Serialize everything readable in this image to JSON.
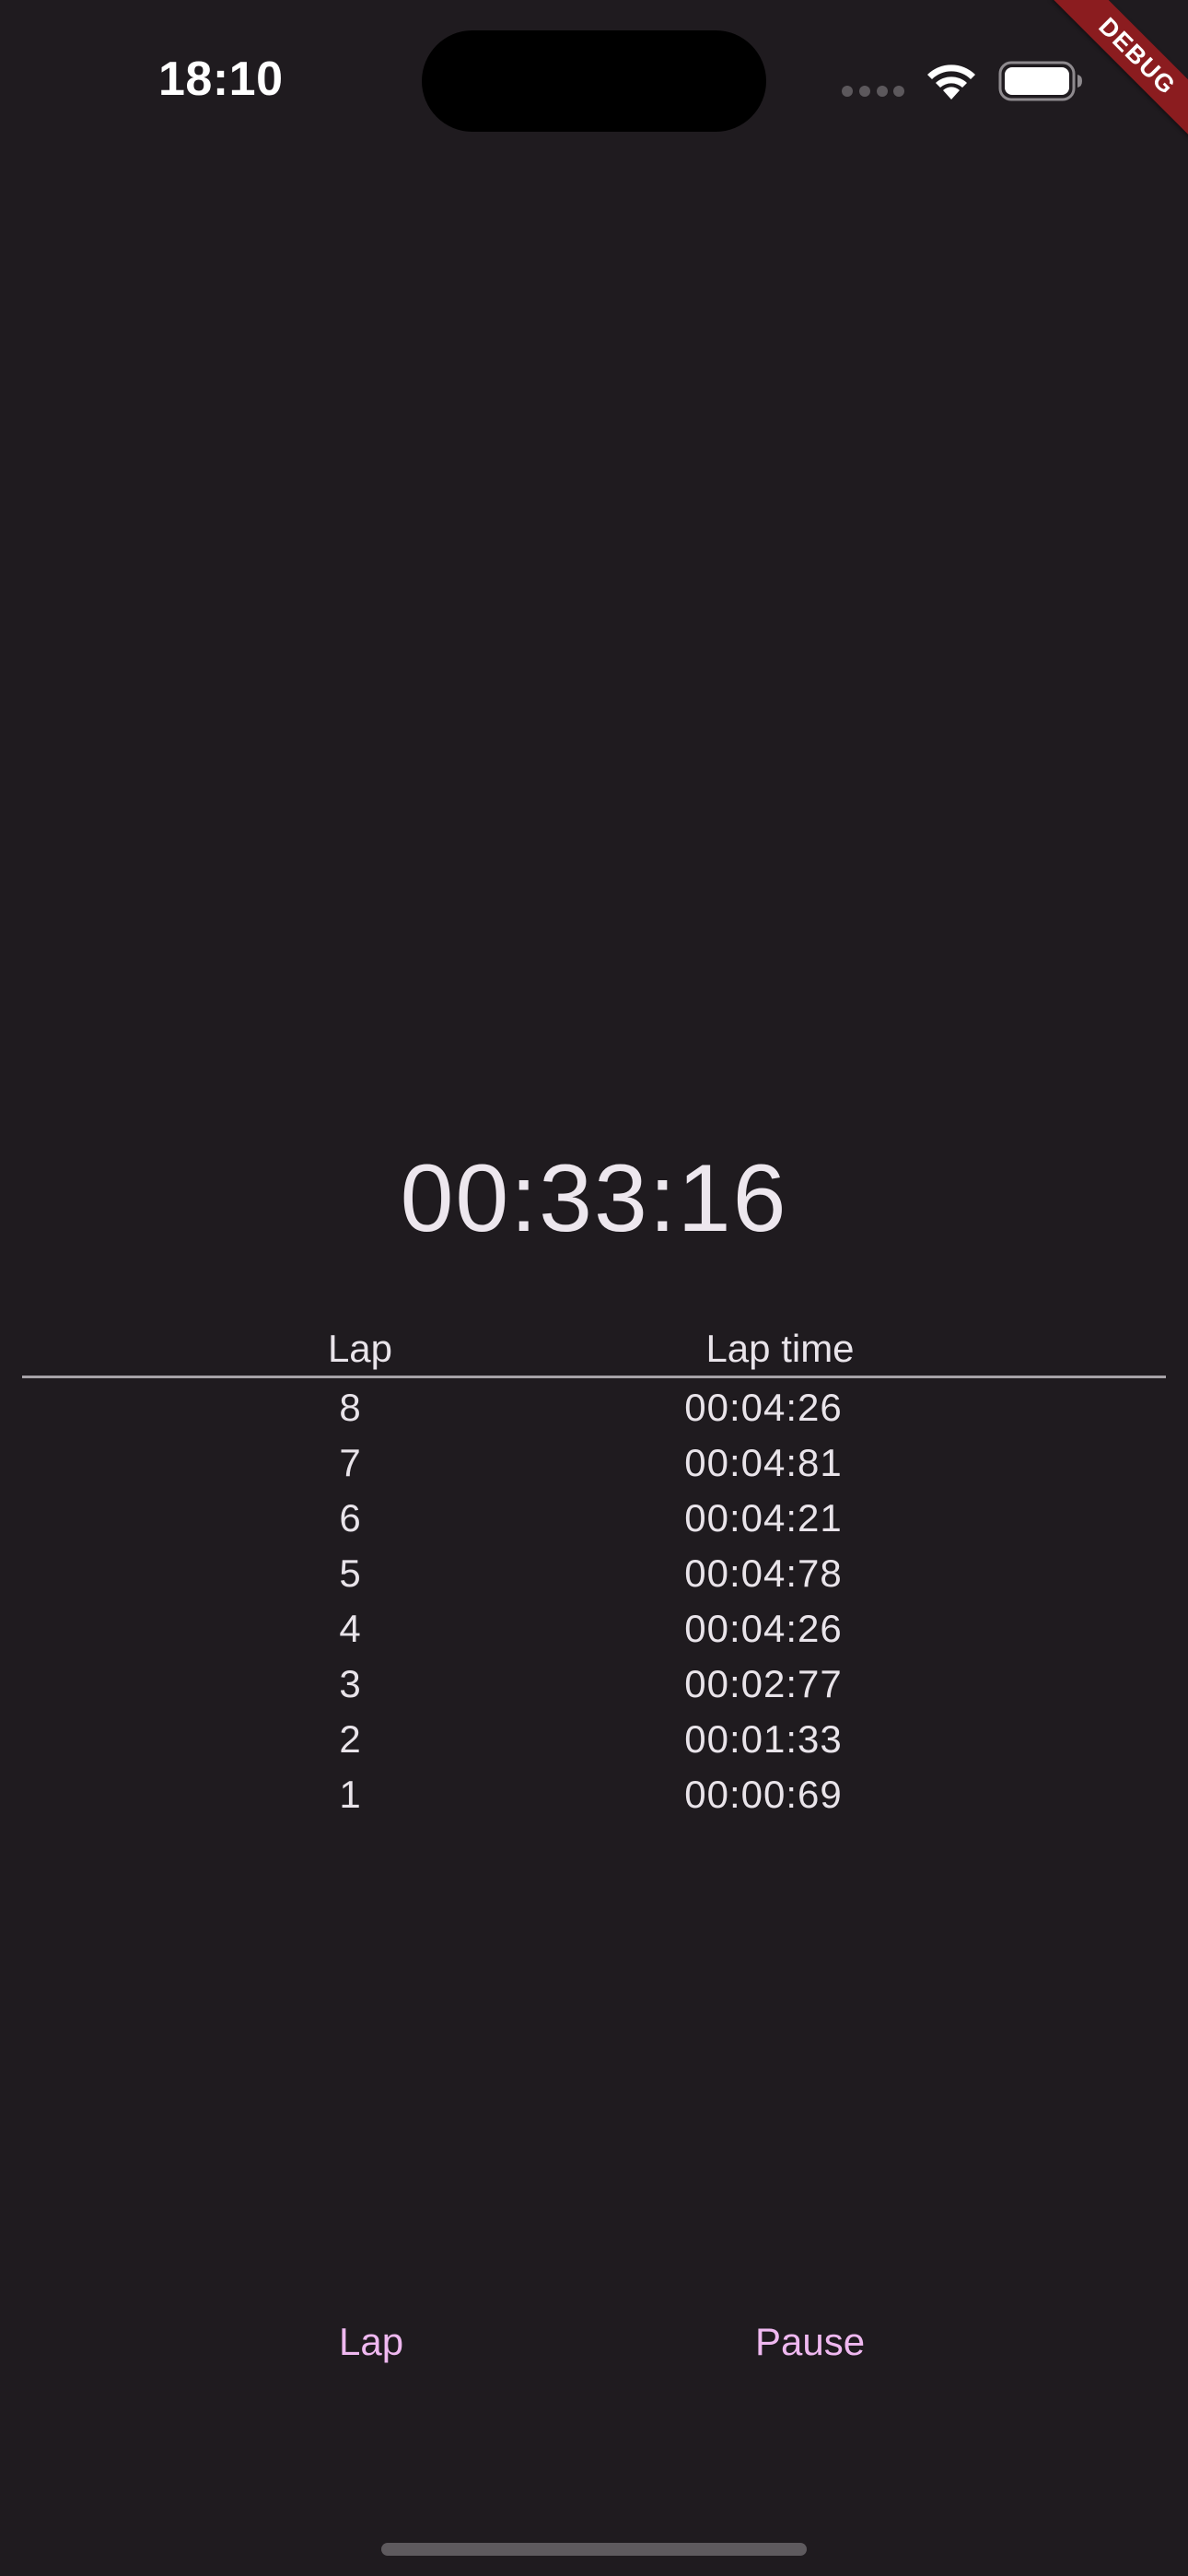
{
  "status_bar": {
    "time": "18:10",
    "wifi_icon": "wifi-icon",
    "battery_icon": "battery-icon",
    "signal_icon": "cellular-signal-icon"
  },
  "debug_banner": "DEBUG",
  "stopwatch": {
    "elapsed": "00:33:16"
  },
  "lap_table": {
    "headers": {
      "lap": "Lap",
      "lap_time": "Lap time"
    },
    "rows": [
      {
        "lap": "8",
        "time": "00:04:26"
      },
      {
        "lap": "7",
        "time": "00:04:81"
      },
      {
        "lap": "6",
        "time": "00:04:21"
      },
      {
        "lap": "5",
        "time": "00:04:78"
      },
      {
        "lap": "4",
        "time": "00:04:26"
      },
      {
        "lap": "3",
        "time": "00:02:77"
      },
      {
        "lap": "2",
        "time": "00:01:33"
      },
      {
        "lap": "1",
        "time": "00:00:69"
      }
    ]
  },
  "actions": {
    "lap_label": "Lap",
    "pause_label": "Pause"
  },
  "colors": {
    "background": "#1f1b1f",
    "accent": "#efb8f0",
    "debug_ribbon": "#8b1c1f",
    "divider": "#a7a3a8"
  }
}
